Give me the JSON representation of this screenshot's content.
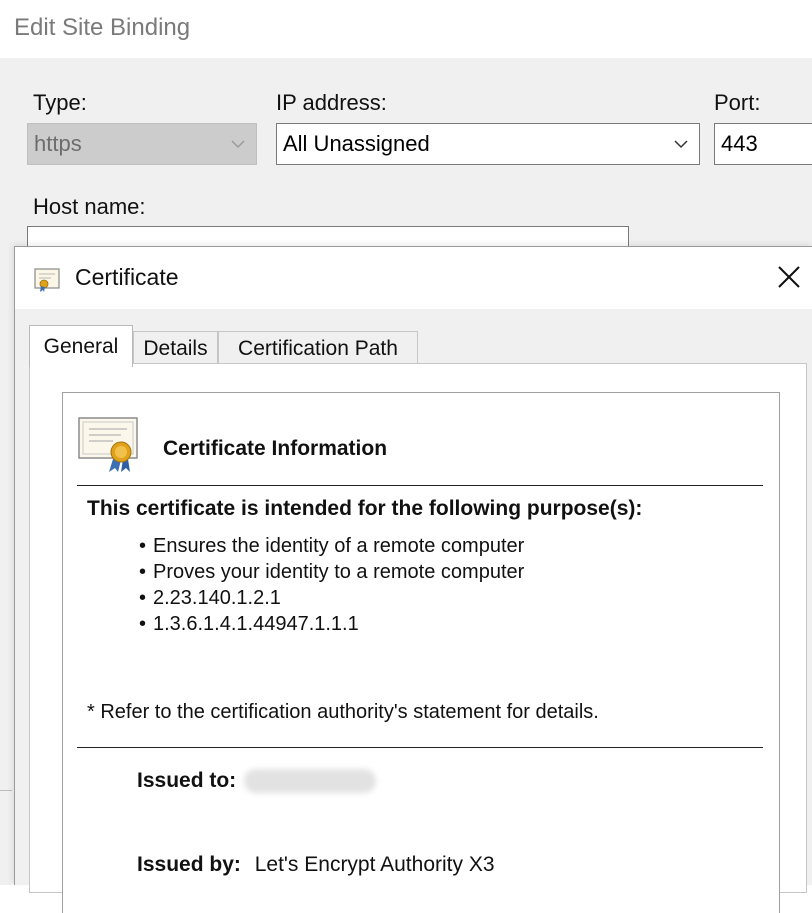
{
  "edit_site_binding": {
    "title": "Edit Site Binding",
    "type_label": "Type:",
    "type_value": "https",
    "ip_label": "IP address:",
    "ip_value": "All Unassigned",
    "port_label": "Port:",
    "port_value": "443",
    "hostname_label": "Host name:"
  },
  "certificate_dialog": {
    "title": "Certificate",
    "tabs": [
      {
        "label": "General",
        "active": true
      },
      {
        "label": "Details",
        "active": false
      },
      {
        "label": "Certification Path",
        "active": false
      }
    ],
    "info_heading": "Certificate Information",
    "purpose_heading": "This certificate is intended for the following purpose(s):",
    "purposes": [
      "Ensures the identity of a remote computer",
      "Proves your identity to a remote computer",
      "2.23.140.1.2.1",
      "1.3.6.1.4.1.44947.1.1.1"
    ],
    "refer_note": "* Refer to the certification authority's statement for details.",
    "issued_to_label": "Issued to:",
    "issued_by_label": "Issued by:",
    "issued_by_value": "Let's Encrypt Authority X3"
  },
  "colors": {
    "window_bg": "#f0f0f0",
    "disabled_combo": "#cccccc",
    "certificate_seal": "#e0a21a"
  },
  "icons": [
    "chevron-down-icon",
    "certificate-icon",
    "close-icon",
    "certificate-seal-icon"
  ]
}
